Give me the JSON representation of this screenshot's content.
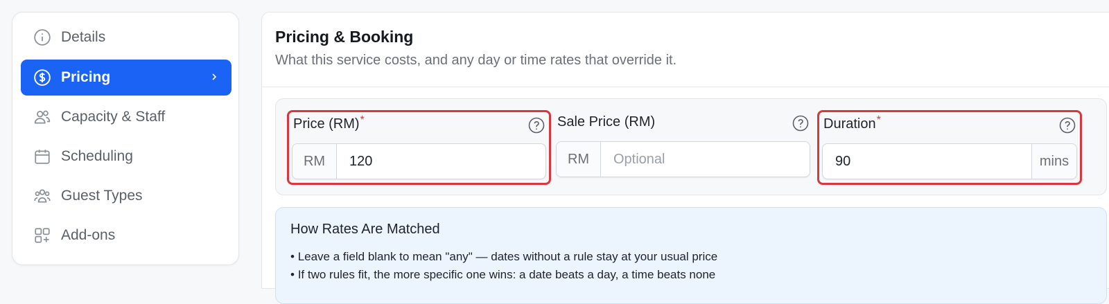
{
  "sidebar": {
    "items": [
      {
        "label": "Details",
        "icon": "info-circle-icon"
      },
      {
        "label": "Pricing",
        "icon": "dollar-circle-icon",
        "active": true
      },
      {
        "label": "Capacity & Staff",
        "icon": "users-icon"
      },
      {
        "label": "Scheduling",
        "icon": "calendar-icon"
      },
      {
        "label": "Guest Types",
        "icon": "group-icon"
      },
      {
        "label": "Add-ons",
        "icon": "grid-plus-icon"
      }
    ]
  },
  "main": {
    "title": "Pricing & Booking",
    "subtitle": "What this service costs, and any day or time rates that override it.",
    "fields": {
      "price": {
        "label": "Price (RM)",
        "required": "*",
        "prefix": "RM",
        "value": "120"
      },
      "sale_price": {
        "label": "Sale Price (RM)",
        "prefix": "RM",
        "value": "",
        "placeholder": "Optional"
      },
      "duration": {
        "label": "Duration",
        "required": "*",
        "value": "90",
        "suffix": "mins"
      }
    },
    "info": {
      "title": "How Rates Are Matched",
      "items": [
        "Leave a field blank to mean \"any\" — dates without a rule stay at your usual price",
        "If two rules fit, the more specific one wins: a date beats a day, a time beats none"
      ]
    }
  },
  "colors": {
    "accent": "#1a63f5",
    "highlight": "#d9363e",
    "info_bg": "#ecf4fe"
  }
}
